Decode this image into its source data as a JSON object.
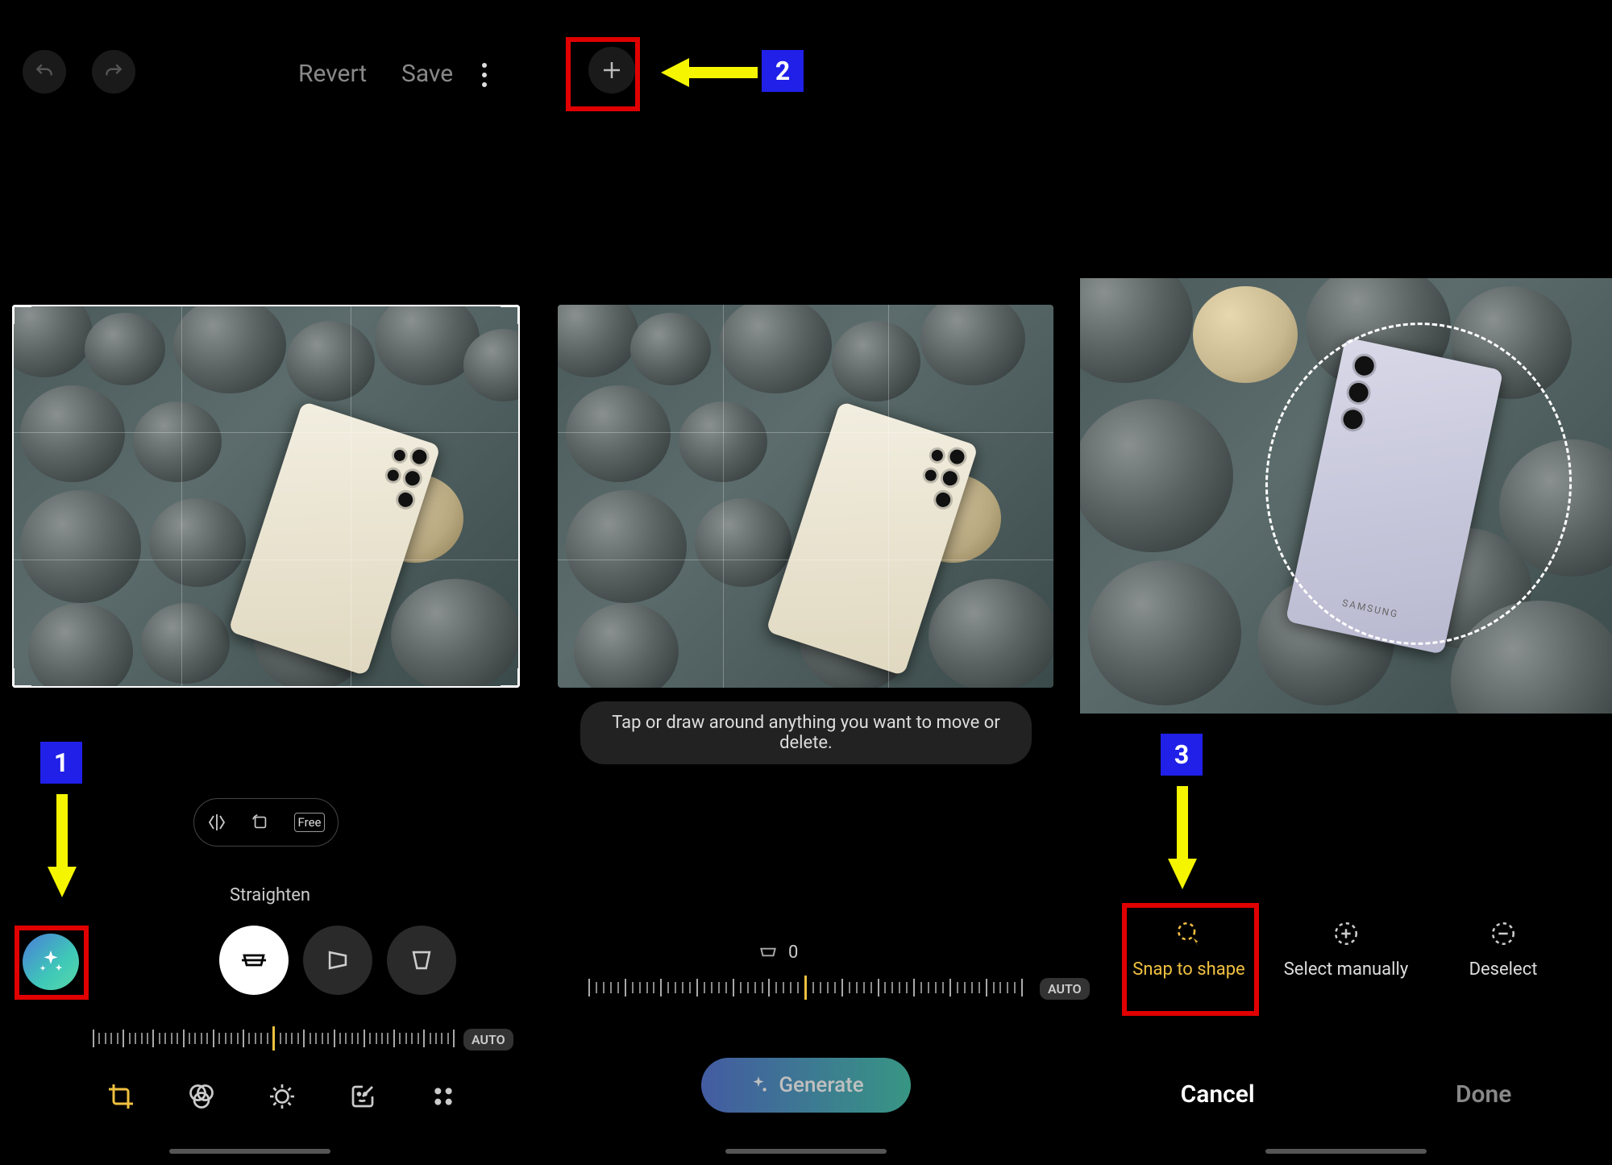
{
  "panel1": {
    "revert_label": "Revert",
    "save_label": "Save",
    "aspect_free_label": "Free",
    "straighten_label": "Straighten",
    "auto_label": "AUTO"
  },
  "panel2": {
    "hint_text": "Tap or draw around anything you want to move or delete.",
    "straighten_value": "0",
    "auto_label": "AUTO",
    "generate_label": "Generate"
  },
  "panel3": {
    "snap_label": "Snap to shape",
    "manual_label": "Select manually",
    "deselect_label": "Deselect",
    "cancel_label": "Cancel",
    "done_label": "Done"
  },
  "markers": {
    "m1": "1",
    "m2": "2",
    "m3": "3"
  }
}
